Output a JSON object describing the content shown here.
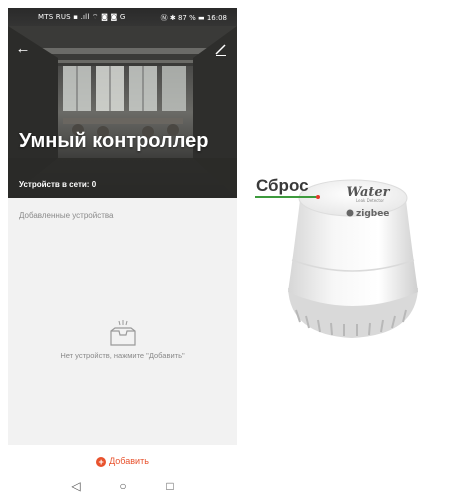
{
  "status_bar": {
    "left": "MTS RUS ▪ .ıll ⌔ ◙ ◙ G",
    "right": "Ⓝ ✱ 87 % ▬ 16:08"
  },
  "header": {
    "title": "Умный контроллер",
    "devices_online": "Устройств в сети: 0"
  },
  "section": {
    "label": "Добавленные устройства"
  },
  "empty_state": {
    "message": "Нет устройств, нажмите \"Добавить\""
  },
  "actions": {
    "add_label": "Добавить"
  },
  "icons": {
    "back": "arrow-left-icon",
    "edit": "pencil-icon",
    "empty": "empty-tray-icon",
    "add": "plus-circle-icon",
    "nav_back": "triangle-back-icon",
    "nav_home": "circle-home-icon",
    "nav_recent": "square-recent-icon"
  },
  "product": {
    "reset_label": "Сброс",
    "brand_text": "Water",
    "sub_text": "Leak Detector",
    "protocol_text": "zigbee"
  },
  "colors": {
    "accent": "#e8522d",
    "screen_bg": "#f2f2f2",
    "reset_underline": "#3d9a3d",
    "reset_dot": "#e53b2c"
  }
}
